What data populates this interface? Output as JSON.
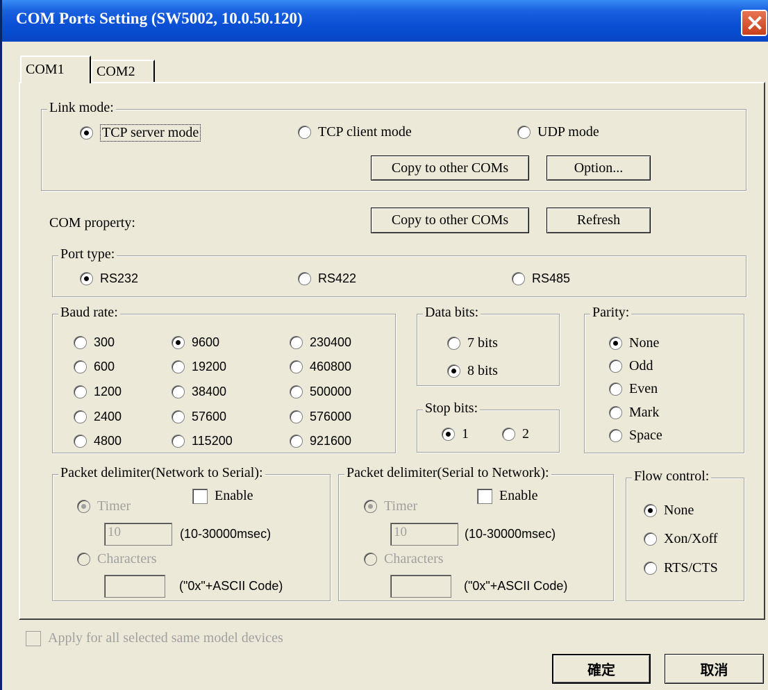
{
  "window": {
    "title": "COM Ports Setting (SW5002, 10.0.50.120)"
  },
  "tabs": [
    {
      "label": "COM1",
      "selected": true
    },
    {
      "label": "COM2",
      "selected": false
    }
  ],
  "link_mode": {
    "title": "Link mode:",
    "options": [
      {
        "label": "TCP server mode",
        "selected": true
      },
      {
        "label": "TCP client mode",
        "selected": false
      },
      {
        "label": "UDP mode",
        "selected": false
      }
    ],
    "copy_button": "Copy to other COMs",
    "option_button": "Option..."
  },
  "com_property": {
    "label": "COM property:",
    "copy_button": "Copy to other COMs",
    "refresh_button": "Refresh"
  },
  "port_type": {
    "title": "Port type:",
    "options": [
      {
        "label": "RS232",
        "selected": true
      },
      {
        "label": "RS422",
        "selected": false
      },
      {
        "label": "RS485",
        "selected": false
      }
    ]
  },
  "baud_rate": {
    "title": "Baud rate:",
    "options": [
      {
        "label": "300",
        "selected": false
      },
      {
        "label": "600",
        "selected": false
      },
      {
        "label": "1200",
        "selected": false
      },
      {
        "label": "2400",
        "selected": false
      },
      {
        "label": "4800",
        "selected": false
      },
      {
        "label": "9600",
        "selected": true
      },
      {
        "label": "19200",
        "selected": false
      },
      {
        "label": "38400",
        "selected": false
      },
      {
        "label": "57600",
        "selected": false
      },
      {
        "label": "115200",
        "selected": false
      },
      {
        "label": "230400",
        "selected": false
      },
      {
        "label": "460800",
        "selected": false
      },
      {
        "label": "500000",
        "selected": false
      },
      {
        "label": "576000",
        "selected": false
      },
      {
        "label": "921600",
        "selected": false
      }
    ]
  },
  "data_bits": {
    "title": "Data bits:",
    "options": [
      {
        "label": "7 bits",
        "selected": false
      },
      {
        "label": "8 bits",
        "selected": true
      }
    ]
  },
  "stop_bits": {
    "title": "Stop bits:",
    "options": [
      {
        "label": "1",
        "selected": true
      },
      {
        "label": "2",
        "selected": false
      }
    ]
  },
  "parity": {
    "title": "Parity:",
    "options": [
      {
        "label": "None",
        "selected": true
      },
      {
        "label": "Odd",
        "selected": false
      },
      {
        "label": "Even",
        "selected": false
      },
      {
        "label": "Mark",
        "selected": false
      },
      {
        "label": "Space",
        "selected": false
      }
    ]
  },
  "delimiter_net_to_serial": {
    "title": "Packet delimiter(Network to Serial):",
    "enable_label": "Enable",
    "enabled": false,
    "timer_label": "Timer",
    "timer_value": "10",
    "timer_range": "(10-30000msec)",
    "characters_label": "Characters",
    "characters_value": "",
    "characters_hint": "(\"0x\"+ASCII Code)"
  },
  "delimiter_serial_to_net": {
    "title": "Packet delimiter(Serial to Network):",
    "enable_label": "Enable",
    "enabled": false,
    "timer_label": "Timer",
    "timer_value": "10",
    "timer_range": "(10-30000msec)",
    "characters_label": "Characters",
    "characters_value": "",
    "characters_hint": "(\"0x\"+ASCII Code)"
  },
  "flow_control": {
    "title": "Flow control:",
    "options": [
      {
        "label": "None",
        "selected": true
      },
      {
        "label": "Xon/Xoff",
        "selected": false
      },
      {
        "label": "RTS/CTS",
        "selected": false
      }
    ]
  },
  "apply_all": {
    "label": "Apply for all selected same model devices",
    "checked": false
  },
  "footer": {
    "ok_button": "確定",
    "cancel_button": "取消"
  }
}
